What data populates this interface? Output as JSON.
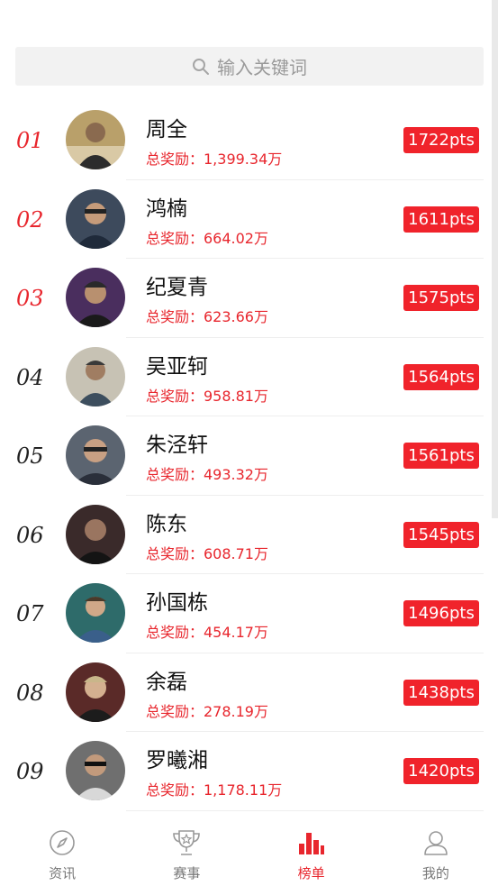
{
  "search": {
    "placeholder": "输入关键词"
  },
  "players": [
    {
      "rank": "01",
      "name": "周全",
      "prize": "总奖励：1,399.34万",
      "pts": "1722pts"
    },
    {
      "rank": "02",
      "name": "鸿楠",
      "prize": "总奖励：664.02万",
      "pts": "1611pts"
    },
    {
      "rank": "03",
      "name": "纪夏青",
      "prize": "总奖励：623.66万",
      "pts": "1575pts"
    },
    {
      "rank": "04",
      "name": "吴亚轲",
      "prize": "总奖励：958.81万",
      "pts": "1564pts"
    },
    {
      "rank": "05",
      "name": "朱泾轩",
      "prize": "总奖励：493.32万",
      "pts": "1561pts"
    },
    {
      "rank": "06",
      "name": "陈东",
      "prize": "总奖励：608.71万",
      "pts": "1545pts"
    },
    {
      "rank": "07",
      "name": "孙国栋",
      "prize": "总奖励：454.17万",
      "pts": "1496pts"
    },
    {
      "rank": "08",
      "name": "余磊",
      "prize": "总奖励：278.19万",
      "pts": "1438pts"
    },
    {
      "rank": "09",
      "name": "罗曦湘",
      "prize": "总奖励：1,178.11万",
      "pts": "1420pts"
    }
  ],
  "tabs": [
    {
      "label": "资讯",
      "icon": "compass-icon"
    },
    {
      "label": "赛事",
      "icon": "trophy-icon"
    },
    {
      "label": "榜单",
      "icon": "bar-chart-icon",
      "active": true
    },
    {
      "label": "我的",
      "icon": "user-icon"
    }
  ],
  "colors": {
    "accent": "#e8262d",
    "badge": "#f0232b",
    "inactive": "#777777"
  }
}
